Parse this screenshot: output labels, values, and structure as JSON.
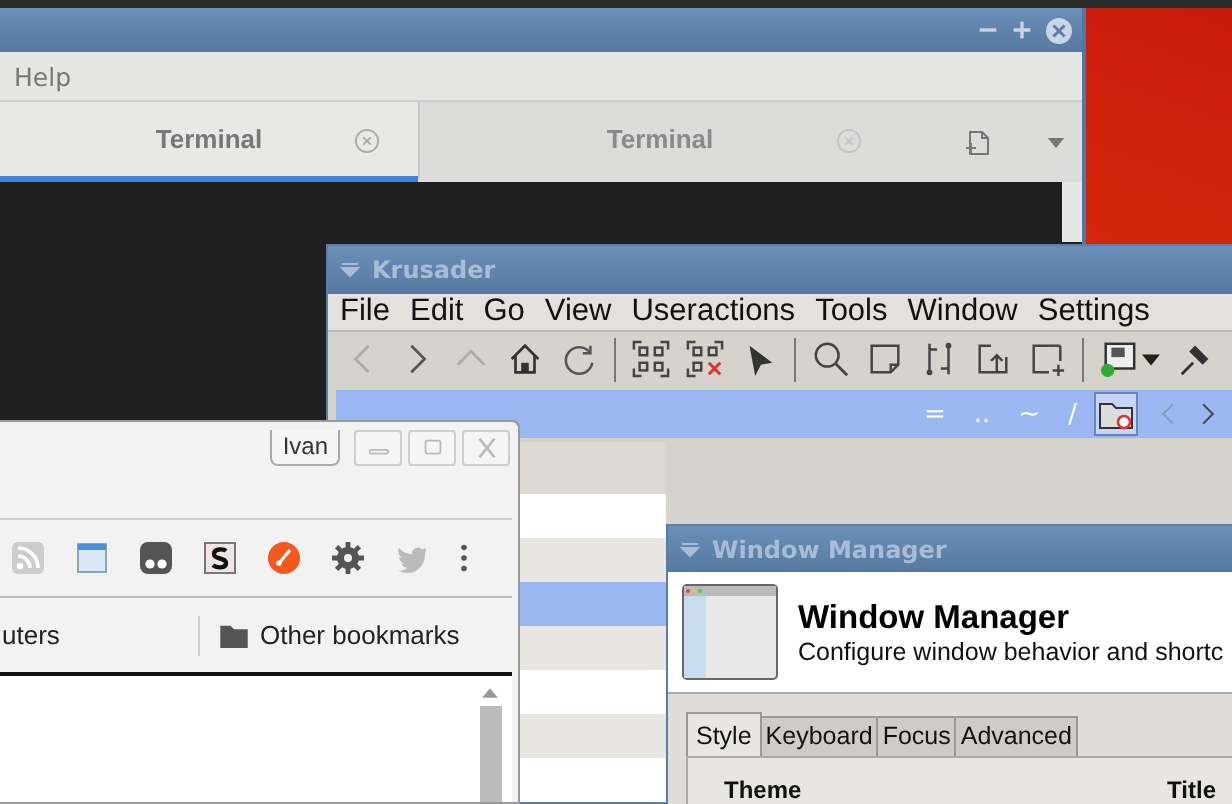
{
  "terminal": {
    "menu": [
      "Help"
    ],
    "tabs": [
      {
        "label": "Terminal",
        "selected": true
      },
      {
        "label": "Terminal",
        "selected": false
      }
    ]
  },
  "krusader": {
    "title": "Krusader",
    "menu": [
      "File",
      "Edit",
      "Go",
      "View",
      "Useractions",
      "Tools",
      "Window",
      "Settings"
    ],
    "path_buttons": [
      "=",
      "..",
      "~",
      "/"
    ],
    "rows": [
      {
        "selected": false
      },
      {
        "selected": false
      },
      {
        "selected": true
      },
      {
        "selected": false
      },
      {
        "selected": false
      },
      {
        "selected": false
      },
      {
        "selected": false
      }
    ]
  },
  "browser": {
    "profile": "Ivan",
    "bookmarks": [
      "uters"
    ],
    "other_bookmarks": "Other bookmarks"
  },
  "window_manager": {
    "title": "Window Manager",
    "heading": "Window Manager",
    "subtitle": "Configure window behavior and shortc",
    "tabs": [
      {
        "label": "Style",
        "selected": true
      },
      {
        "label": "Keyboard",
        "selected": false
      },
      {
        "label": "Focus",
        "selected": false
      },
      {
        "label": "Advanced",
        "selected": false
      }
    ],
    "columns": [
      "Theme",
      "Title"
    ]
  }
}
